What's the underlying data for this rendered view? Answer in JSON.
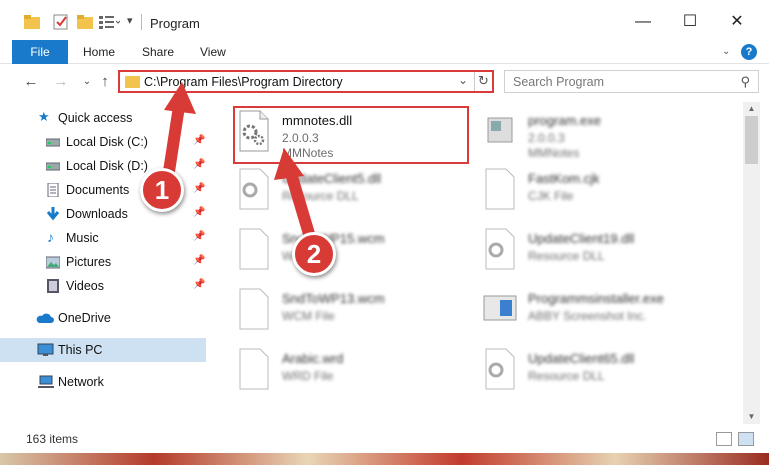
{
  "window": {
    "title": "Program"
  },
  "ribbon": {
    "file": "File",
    "home": "Home",
    "share": "Share",
    "view": "View",
    "help": "?"
  },
  "address": {
    "path": "C:\\Program Files\\Program Directory"
  },
  "search": {
    "placeholder": "Search Program"
  },
  "sidebar": {
    "items": [
      {
        "label": "Quick access",
        "icon": "star-icon",
        "pinned": false
      },
      {
        "label": "Local Disk (C:)",
        "icon": "drive-icon",
        "pinned": true
      },
      {
        "label": "Local Disk (D:)",
        "icon": "drive-icon",
        "pinned": true
      },
      {
        "label": "Documents",
        "icon": "documents-icon",
        "pinned": true
      },
      {
        "label": "Downloads",
        "icon": "download-icon",
        "pinned": true
      },
      {
        "label": "Music",
        "icon": "music-icon",
        "pinned": true
      },
      {
        "label": "Pictures",
        "icon": "pictures-icon",
        "pinned": true
      },
      {
        "label": "Videos",
        "icon": "videos-icon",
        "pinned": true
      },
      {
        "label": "OneDrive",
        "icon": "cloud-icon",
        "pinned": false
      },
      {
        "label": "This PC",
        "icon": "computer-icon",
        "pinned": false,
        "selected": true
      },
      {
        "label": "Network",
        "icon": "network-icon",
        "pinned": false
      }
    ]
  },
  "files": [
    {
      "name": "mmnotes.dll",
      "line1": "2.0.0.3",
      "line2": "MMNotes",
      "icon": "dll-gear-icon",
      "highlighted": true
    },
    {
      "name": "program.exe",
      "line1": "2.0.0.3",
      "line2": "MMNotes",
      "icon": "exe-icon"
    },
    {
      "name": "UpdateClient5.dll",
      "line1": "Resource DLL",
      "line2": "",
      "icon": "dll-gear-icon"
    },
    {
      "name": "FastKom.cjk",
      "line1": "CJK File",
      "line2": "",
      "icon": "blank-file-icon"
    },
    {
      "name": "SndToWP15.wcm",
      "line1": "WCM File",
      "line2": "",
      "icon": "blank-file-icon"
    },
    {
      "name": "UpdateClient19.dll",
      "line1": "Resource DLL",
      "line2": "",
      "icon": "dll-gear-icon"
    },
    {
      "name": "SndToWP13.wcm",
      "line1": "WCM File",
      "line2": "",
      "icon": "blank-file-icon"
    },
    {
      "name": "Programmsinstaller.exe",
      "line1": "ABBY Screenshot Inc.",
      "line2": "",
      "icon": "installer-icon"
    },
    {
      "name": "Arabic.wrd",
      "line1": "WRD File",
      "line2": "",
      "icon": "blank-file-icon"
    },
    {
      "name": "UpdateClient65.dll",
      "line1": "Resource DLL",
      "line2": "",
      "icon": "dll-gear-icon"
    }
  ],
  "status": {
    "count": "163 items"
  },
  "callouts": {
    "one": "1",
    "two": "2"
  },
  "colors": {
    "accent": "#1979ca",
    "highlight": "#d93a3a",
    "selection": "#cde1f3"
  }
}
